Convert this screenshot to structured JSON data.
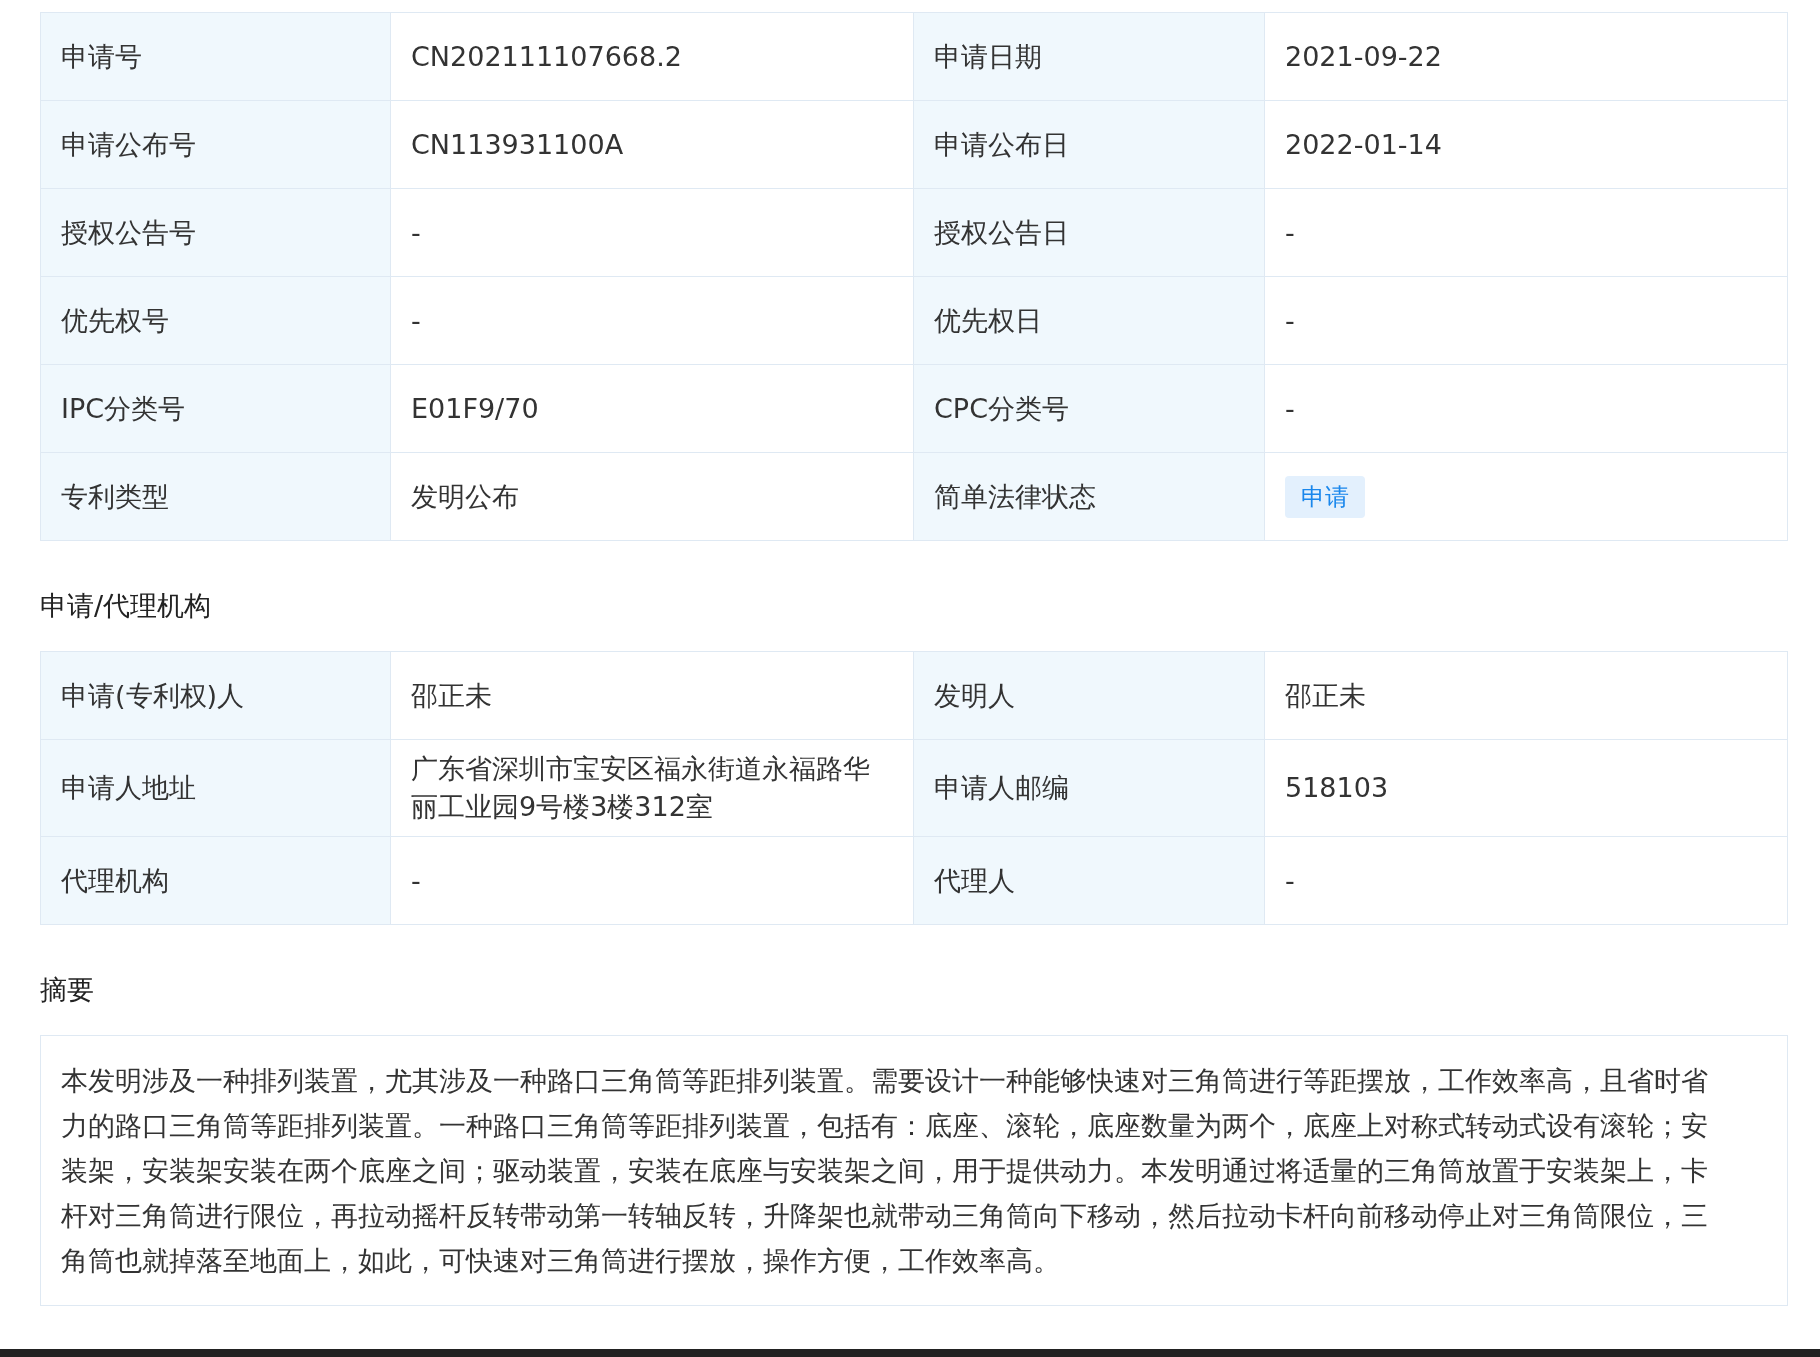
{
  "basic_info": {
    "rows": [
      {
        "cells": [
          {
            "kind": "label",
            "text": "申请号"
          },
          {
            "kind": "value",
            "text": "CN202111107668.2"
          },
          {
            "kind": "label",
            "text": "申请日期"
          },
          {
            "kind": "value",
            "text": "2021-09-22"
          }
        ]
      },
      {
        "cells": [
          {
            "kind": "label",
            "text": "申请公布号"
          },
          {
            "kind": "value",
            "text": "CN113931100A"
          },
          {
            "kind": "label",
            "text": "申请公布日"
          },
          {
            "kind": "value",
            "text": "2022-01-14"
          }
        ]
      },
      {
        "cells": [
          {
            "kind": "label",
            "text": "授权公告号"
          },
          {
            "kind": "value",
            "text": "-"
          },
          {
            "kind": "label",
            "text": "授权公告日"
          },
          {
            "kind": "value",
            "text": "-"
          }
        ]
      },
      {
        "cells": [
          {
            "kind": "label",
            "text": "优先权号"
          },
          {
            "kind": "value",
            "text": "-"
          },
          {
            "kind": "label",
            "text": "优先权日"
          },
          {
            "kind": "value",
            "text": "-"
          }
        ]
      },
      {
        "cells": [
          {
            "kind": "label",
            "text": "IPC分类号"
          },
          {
            "kind": "value",
            "text": "E01F9/70"
          },
          {
            "kind": "label",
            "text": "CPC分类号"
          },
          {
            "kind": "value",
            "text": "-"
          }
        ]
      },
      {
        "cells": [
          {
            "kind": "label",
            "text": "专利类型"
          },
          {
            "kind": "value",
            "text": "发明公布"
          },
          {
            "kind": "label",
            "text": "简单法律状态"
          },
          {
            "kind": "tag",
            "text": "申请"
          }
        ]
      }
    ]
  },
  "applicant_section": {
    "title": "申请/代理机构",
    "rows": [
      {
        "cells": [
          {
            "kind": "label",
            "text": "申请(专利权)人"
          },
          {
            "kind": "value",
            "text": "邵正未"
          },
          {
            "kind": "label",
            "text": "发明人"
          },
          {
            "kind": "value",
            "text": "邵正未"
          }
        ]
      },
      {
        "cells": [
          {
            "kind": "label",
            "text": "申请人地址"
          },
          {
            "kind": "value",
            "text": "广东省深圳市宝安区福永街道永福路华丽工业园9号楼3楼312室"
          },
          {
            "kind": "label",
            "text": "申请人邮编"
          },
          {
            "kind": "value",
            "text": "518103"
          }
        ]
      },
      {
        "cells": [
          {
            "kind": "label",
            "text": "代理机构"
          },
          {
            "kind": "value",
            "text": "-"
          },
          {
            "kind": "label",
            "text": "代理人"
          },
          {
            "kind": "value",
            "text": "-"
          }
        ]
      }
    ]
  },
  "abstract_section": {
    "title": "摘要",
    "text": "本发明涉及一种排列装置，尤其涉及一种路口三角筒等距排列装置。需要设计一种能够快速对三角筒进行等距摆放，工作效率高，且省时省力的路口三角筒等距排列装置。一种路口三角筒等距排列装置，包括有：底座、滚轮，底座数量为两个，底座上对称式转动式设有滚轮；安装架，安装架安装在两个底座之间；驱动装置，安装在底座与安装架之间，用于提供动力。本发明通过将适量的三角筒放置于安装架上，卡杆对三角筒进行限位，再拉动摇杆反转带动第一转轴反转，升降架也就带动三角筒向下移动，然后拉动卡杆向前移动停止对三角筒限位，三角筒也就掉落至地面上，如此，可快速对三角筒进行摆放，操作方便，工作效率高。"
  }
}
